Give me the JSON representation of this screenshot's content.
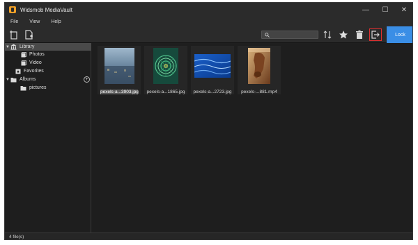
{
  "app": {
    "title": "Widsmob MediaVault"
  },
  "window_controls": {
    "minimize": "—",
    "maximize": "☐",
    "close": "✕"
  },
  "menu": [
    "File",
    "View",
    "Help"
  ],
  "toolbar": {
    "import_file_icon": "import-file-icon",
    "import_folder_icon": "import-folder-icon",
    "search_placeholder": "",
    "lock_label": "Lock"
  },
  "sidebar": {
    "library": {
      "label": "Library",
      "expanded": true,
      "selected": true
    },
    "photos": {
      "label": "Photos"
    },
    "video": {
      "label": "Video"
    },
    "favorites": {
      "label": "Favorites"
    },
    "albums": {
      "label": "Albums",
      "expanded": true
    },
    "pictures": {
      "label": "pictures"
    }
  },
  "files": [
    {
      "name": "pexels-a...3903.jpg",
      "type": "image",
      "selected": true
    },
    {
      "name": "pexels-a...1865.jpg",
      "type": "image",
      "selected": false
    },
    {
      "name": "pexels-a...2723.jpg",
      "type": "image",
      "selected": false
    },
    {
      "name": "pexels-...881.mp4",
      "type": "video",
      "selected": false
    }
  ],
  "status": {
    "file_count": "4 file(s)"
  },
  "colors": {
    "accent": "#3a8ee6",
    "highlight_border": "#e03030",
    "background": "#1e1e1e",
    "panel": "#2b2b2b"
  }
}
